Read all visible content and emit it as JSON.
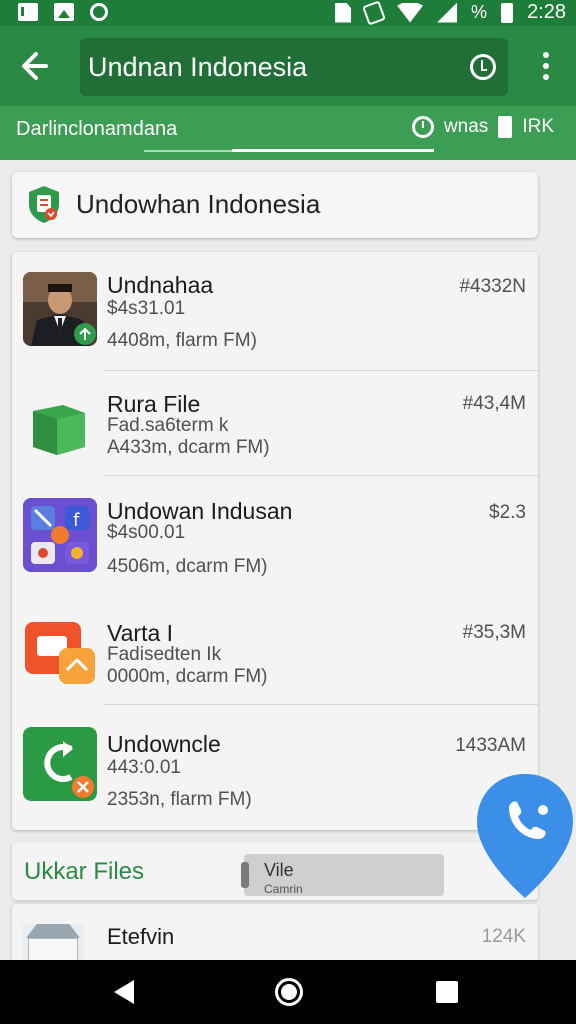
{
  "status_bar": {
    "time": "2:28",
    "battery_text": "%",
    "icons": [
      "mail-icon",
      "photo-icon",
      "circle-icon",
      "sim-icon",
      "vibrate-icon",
      "wifi-icon",
      "signal-icon",
      "battery-icon"
    ]
  },
  "app_bar": {
    "title": "Undnan Indonesia",
    "icons": [
      "back-arrow-icon",
      "history-clock-icon",
      "more-vert-icon"
    ]
  },
  "sub_bar": {
    "breadcrumb": "Darlinclonamdana",
    "sort_label": "wnas",
    "count": "IRK"
  },
  "title_card": {
    "title": "Undowhan Indonesia",
    "icon": "green-shield-icon"
  },
  "items": [
    {
      "name": "Undnahaa",
      "line2": "$4s31.01",
      "line3": "4408m, flarm FM)",
      "size": "#4332N",
      "thumb": "person-photo"
    },
    {
      "name": "Rura File",
      "line2": "Fad.sa6term k",
      "line3": "A433m, dcarm FM)",
      "size": "#43,4M",
      "thumb": "green-cube-icon"
    },
    {
      "name": "Undowan Indusan",
      "line2": "$4s00.01",
      "line3": "4506m, dcarm FM)",
      "size": "$2.3",
      "thumb": "apps-folder-icon"
    },
    {
      "name": "Varta I",
      "line2": "Fadisedten Ik",
      "line3": "0000m, dcarm FM)",
      "size": "#35,3M",
      "thumb": "orange-app-icon"
    },
    {
      "name": "Undowncle",
      "line2": "443:0.01",
      "line3": "2353n, flarm FM)",
      "size": "1433AM",
      "thumb": "green-sync-icon"
    }
  ],
  "files_section": {
    "heading": "Ukkar Files",
    "pill_line1": "Vile",
    "pill_line2": "Camrin"
  },
  "last_item": {
    "name": "Etefvin",
    "size": "124K",
    "thumb": "building-photo"
  },
  "fab": {
    "icon": "phone-icon",
    "color": "#3b8fe8"
  },
  "colors": {
    "primary": "#2a8a43",
    "primary_dark": "#1f7d3a",
    "accent_blue": "#3b8fe8"
  }
}
